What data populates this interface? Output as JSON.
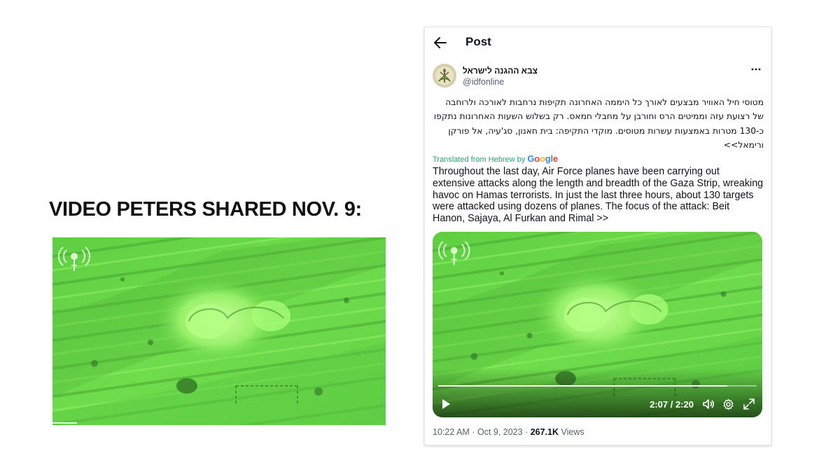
{
  "left": {
    "heading": "VIDEO PETERS SHARED NOV. 9:"
  },
  "post": {
    "header_title": "Post",
    "author_name": "צבא ההגנה לישראל",
    "author_handle": "@idfonline",
    "hebrew_text": "מטוסי חיל האוויר מבצעים לאורך כל היממה האחרונה תקיפות נרחבות לאורכה ולרוחבה של רצועת עזה וממיטים הרס וחורבן על מחבלי חמאס. רק בשלוש השעות האחרונות נתקפו כ-130 מטרות באמצעות עשרות מטוסים. מוקדי התקיפה: בית חאנון, סג'עיה, אל פורקן ורימאל>>",
    "translated_prefix": "Translated from Hebrew by",
    "translated_brand": "Google",
    "english_text": "Throughout the last day, Air Force planes have been carrying out extensive attacks along the length and breadth of the Gaza Strip, wreaking havoc on Hamas terrorists. In just the last three hours, about 130 targets were attacked using dozens of planes. The focus of the attack: Beit Hanon, Sajaya, Al Furkan and Rimal >>",
    "video": {
      "time": "2:07 / 2:20",
      "progress": 0.907
    },
    "meta": {
      "time": "10:22 AM",
      "date": "Oct 9, 2023",
      "views_count": "267.1K",
      "views_label": "Views"
    }
  },
  "colors": {
    "night_vision_green": "#6ad84a",
    "google_blue": "#4285f4",
    "google_red": "#ea4335",
    "google_yellow": "#fbbc05",
    "google_green": "#34a853",
    "translated_green": "#2e9e70"
  },
  "icons": {
    "back": "arrow-left-icon",
    "more": "more-horizontal-icon",
    "broadcast": "broadcast-antenna-icon",
    "play": "play-icon",
    "volume": "volume-icon",
    "settings": "gear-icon",
    "fullscreen": "expand-icon"
  }
}
